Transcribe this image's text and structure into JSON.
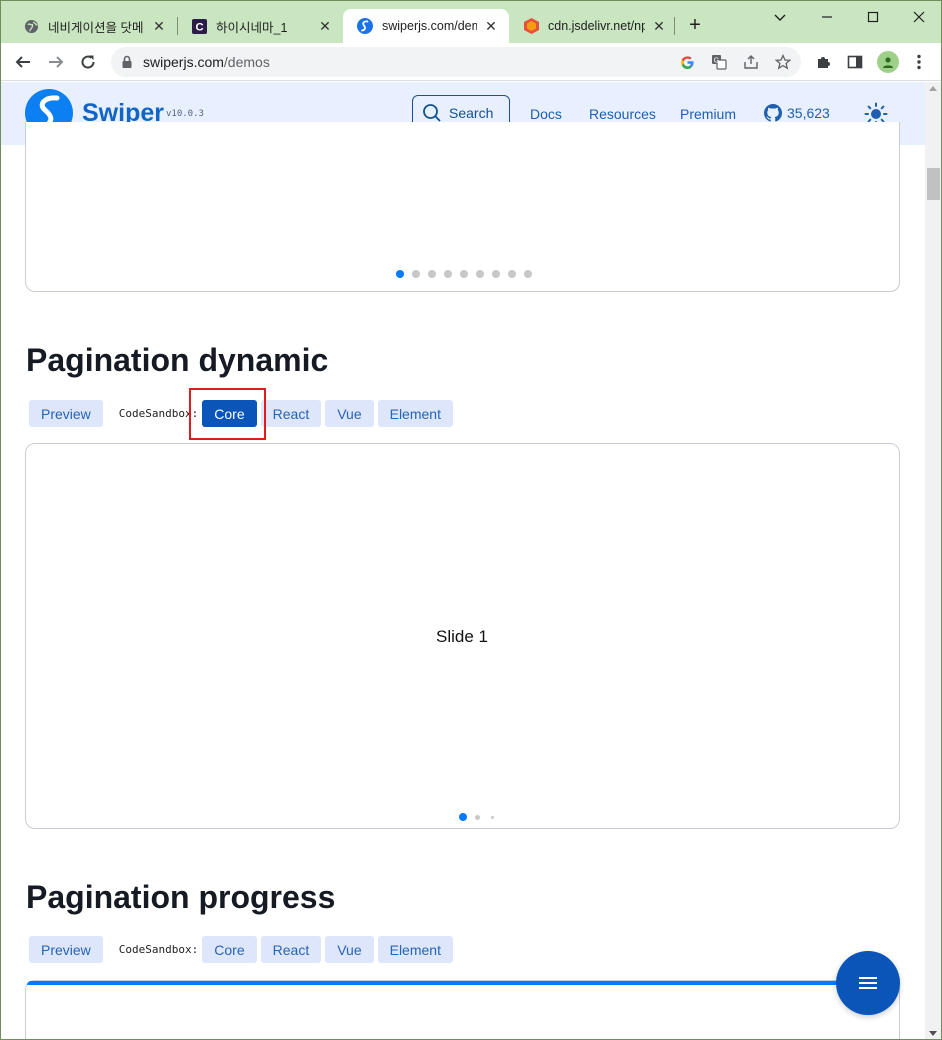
{
  "browser": {
    "tabs": [
      {
        "title": "네비게이션을 닷메",
        "icon": "globe-icon"
      },
      {
        "title": "하이시네마_1",
        "icon": "c-logo-icon"
      },
      {
        "title": "swiperjs.com/demo",
        "icon": "swiper-favicon-icon"
      },
      {
        "title": "cdn.jsdelivr.net/np",
        "icon": "jsdelivr-favicon-icon"
      }
    ],
    "active_tab_index": 2,
    "url_host": "swiperjs.com",
    "url_path": "/demos"
  },
  "site": {
    "brand": "Swiper",
    "version": "v10.0.3",
    "search_label": "Search",
    "nav": {
      "docs": "Docs",
      "resources": "Resources",
      "premium": "Premium"
    },
    "github_stars": "35,623",
    "accent_color": "#1265c8"
  },
  "top_demo": {
    "pagination_count": 9,
    "active_index": 0
  },
  "sections": [
    {
      "title": "Pagination dynamic",
      "preview_label": "Preview",
      "codesandbox_label": "CodeSandbox:",
      "buttons": [
        "Core",
        "React",
        "Vue",
        "Element"
      ],
      "highlighted_button": "Core",
      "slide_text": "Slide 1"
    },
    {
      "title": "Pagination progress",
      "preview_label": "Preview",
      "codesandbox_label": "CodeSandbox:",
      "buttons": [
        "Core",
        "React",
        "Vue",
        "Element"
      ]
    }
  ]
}
